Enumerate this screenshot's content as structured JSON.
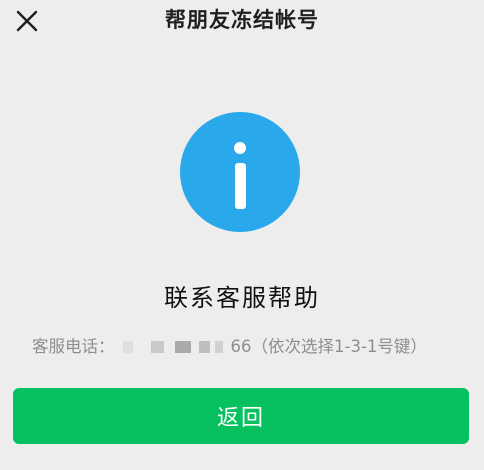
{
  "header": {
    "title": "帮朋友冻结帐号",
    "close_icon": "close-icon"
  },
  "info": {
    "icon": "info-icon",
    "color": "#2aa8ec"
  },
  "main": {
    "title": "联系客服帮助",
    "phone_label": "客服电话：",
    "phone_suffix": "66（依次选择1-3-1号键）"
  },
  "actions": {
    "return_label": "返回",
    "return_color": "#07c160"
  }
}
